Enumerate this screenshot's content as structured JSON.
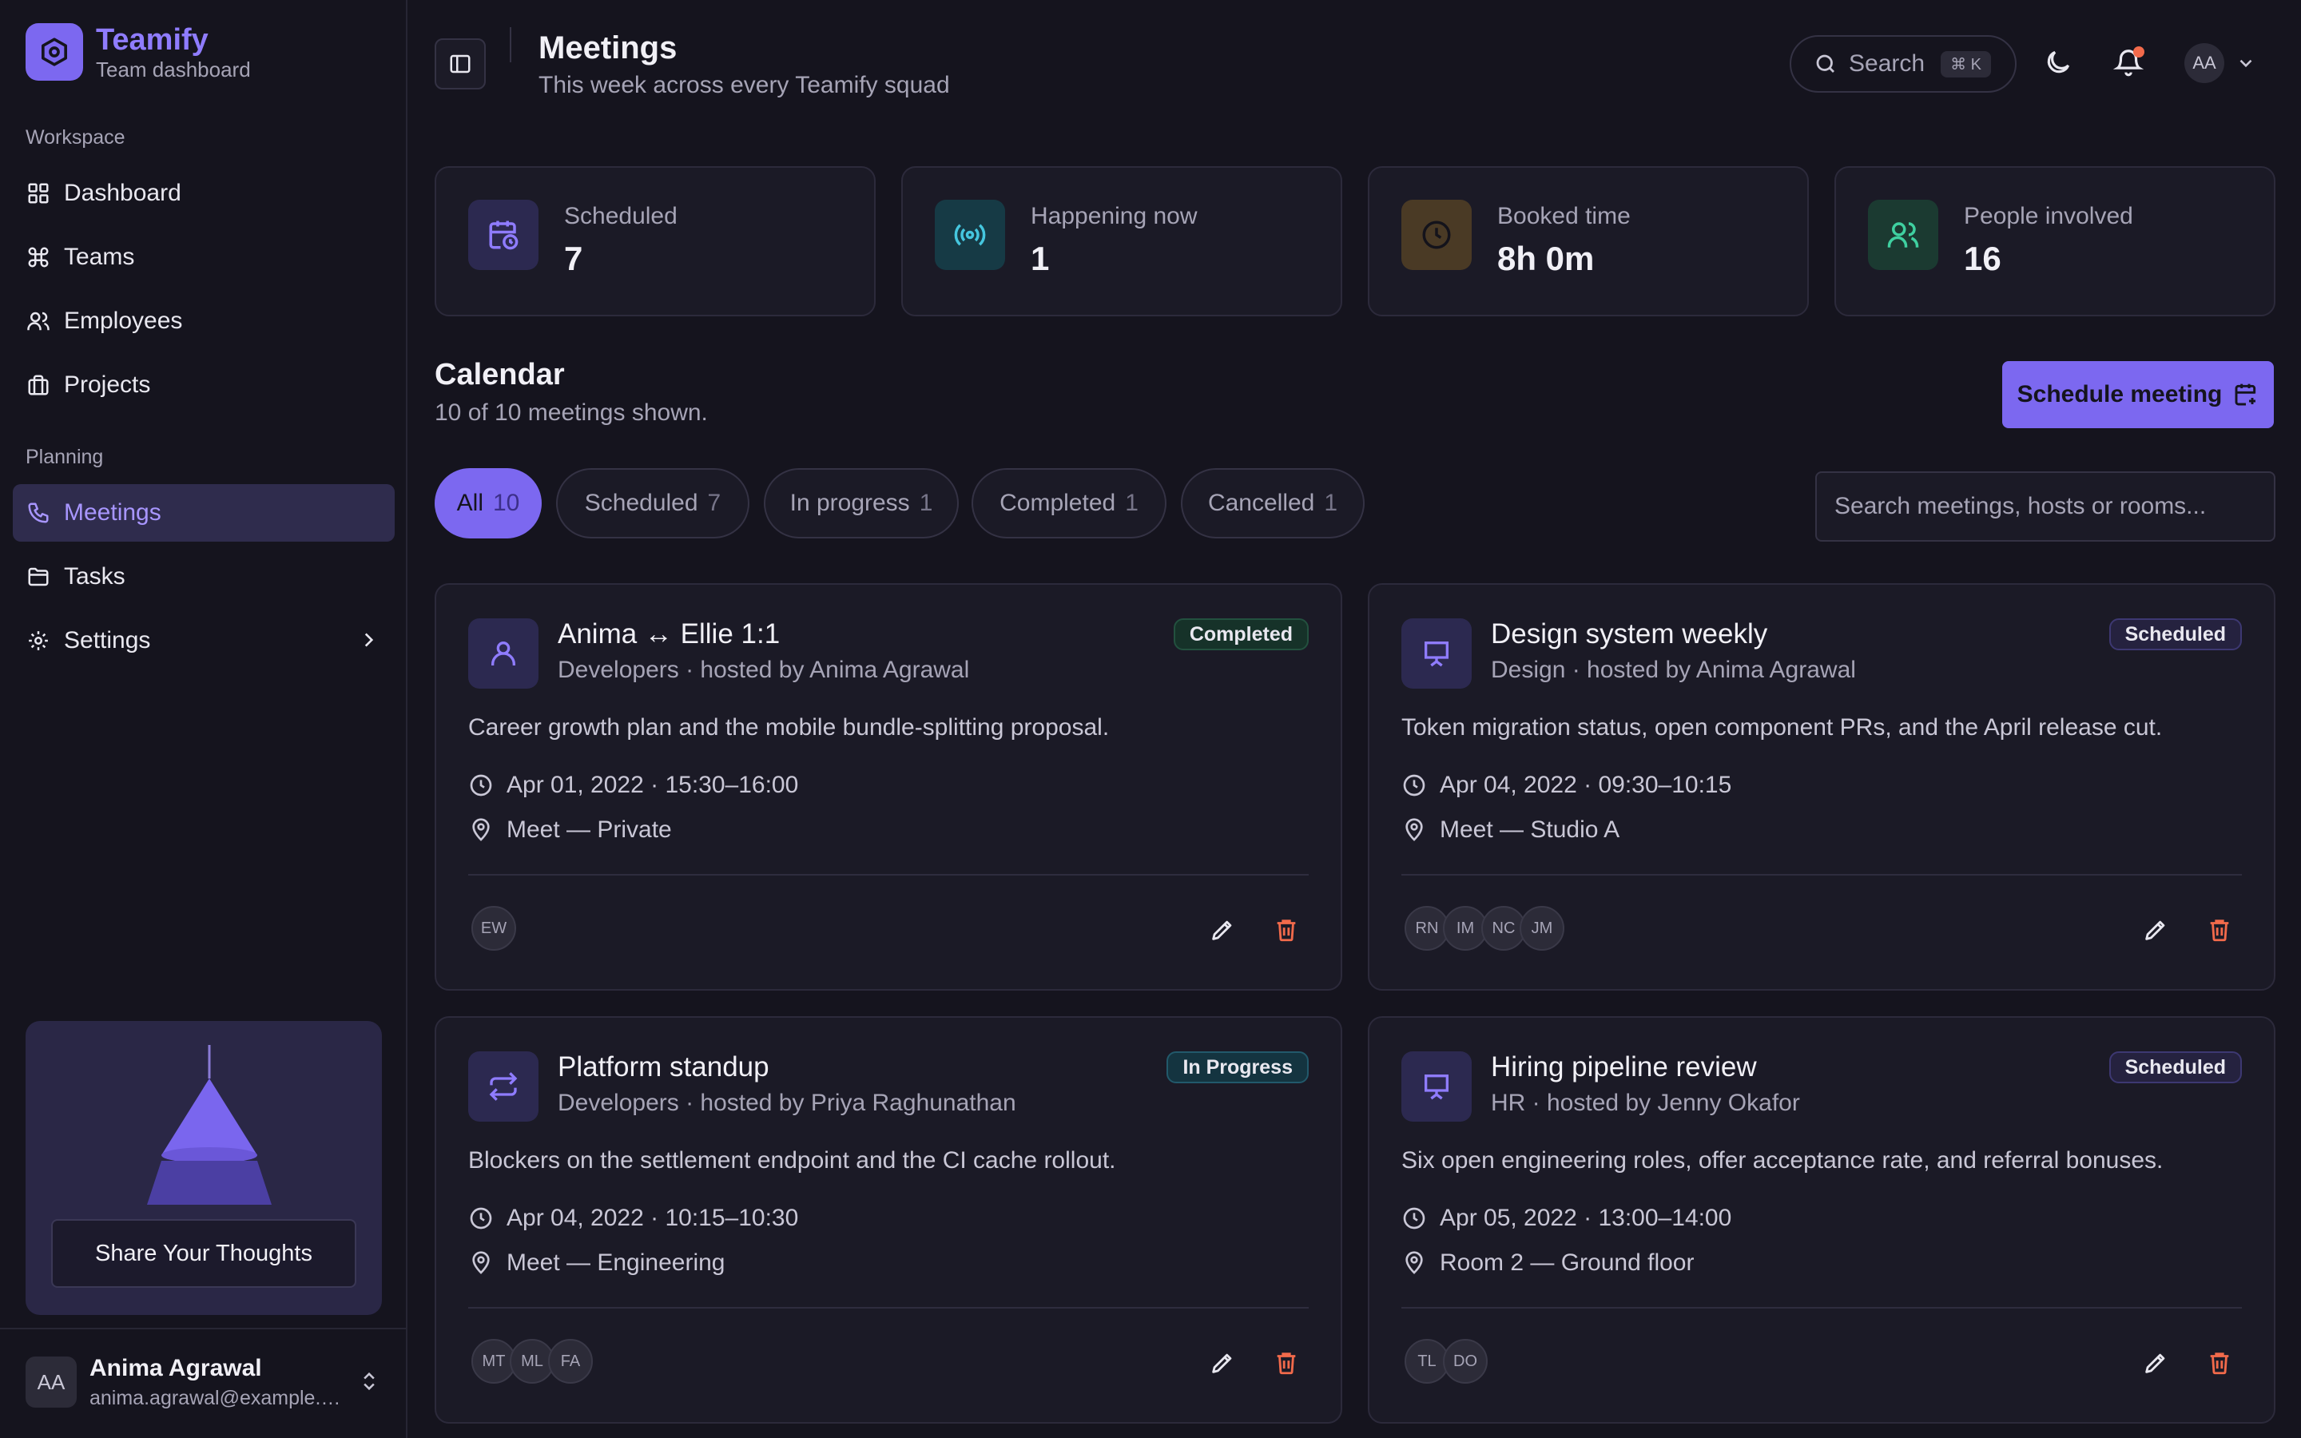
{
  "brand": {
    "name": "Teamify",
    "subtitle": "Team dashboard"
  },
  "sidebar": {
    "section_workspace": "Workspace",
    "section_planning": "Planning",
    "items": [
      {
        "label": "Dashboard",
        "icon": "grid-icon"
      },
      {
        "label": "Teams",
        "icon": "command-icon"
      },
      {
        "label": "Employees",
        "icon": "users-icon"
      },
      {
        "label": "Projects",
        "icon": "briefcase-icon"
      },
      {
        "label": "Meetings",
        "icon": "phone-icon",
        "active": true
      },
      {
        "label": "Tasks",
        "icon": "folder-icon"
      },
      {
        "label": "Settings",
        "icon": "gear-icon"
      }
    ],
    "promo_button": "Share Your Thoughts",
    "user": {
      "initials": "AA",
      "name": "Anima Agrawal",
      "email": "anima.agrawal@example.com"
    }
  },
  "header": {
    "title": "Meetings",
    "subtitle": "This week across every Teamify squad",
    "search_label": "Search",
    "search_shortcut": "⌘ K",
    "avatar_initials": "AA"
  },
  "stats": [
    {
      "label": "Scheduled",
      "value": "7"
    },
    {
      "label": "Happening now",
      "value": "1"
    },
    {
      "label": "Booked time",
      "value": "8h 0m"
    },
    {
      "label": "People involved",
      "value": "16"
    }
  ],
  "calendar": {
    "title": "Calendar",
    "subtitle": "10 of 10 meetings shown.",
    "schedule_button": "Schedule meeting",
    "search_placeholder": "Search meetings, hosts or rooms...",
    "filters": [
      {
        "label": "All",
        "count": "10",
        "active": true
      },
      {
        "label": "Scheduled",
        "count": "7"
      },
      {
        "label": "In progress",
        "count": "1"
      },
      {
        "label": "Completed",
        "count": "1"
      },
      {
        "label": "Cancelled",
        "count": "1"
      }
    ]
  },
  "meetings": [
    {
      "title": "Anima ↔ Ellie 1:1",
      "subtitle": "Developers · hosted by Anima Agrawal",
      "status": "Completed",
      "description": "Career growth plan and the mobile bundle-splitting proposal.",
      "time": "Apr 01, 2022 · 15:30–16:00",
      "location": "Meet — Private",
      "attendees": [
        "EW"
      ],
      "icon": "person-icon"
    },
    {
      "title": "Design system weekly",
      "subtitle": "Design · hosted by Anima Agrawal",
      "status": "Scheduled",
      "description": "Token migration status, open component PRs, and the April release cut.",
      "time": "Apr 04, 2022 · 09:30–10:15",
      "location": "Meet — Studio A",
      "attendees": [
        "RN",
        "IM",
        "NC",
        "JM"
      ],
      "icon": "presentation-icon"
    },
    {
      "title": "Platform standup",
      "subtitle": "Developers · hosted by Priya Raghunathan",
      "status": "In Progress",
      "description": "Blockers on the settlement endpoint and the CI cache rollout.",
      "time": "Apr 04, 2022 · 10:15–10:30",
      "location": "Meet — Engineering",
      "attendees": [
        "MT",
        "ML",
        "FA"
      ],
      "icon": "repeat-icon"
    },
    {
      "title": "Hiring pipeline review",
      "subtitle": "HR · hosted by Jenny Okafor",
      "status": "Scheduled",
      "description": "Six open engineering roles, offer acceptance rate, and referral bonuses.",
      "time": "Apr 05, 2022 · 13:00–14:00",
      "location": "Room 2 — Ground floor",
      "attendees": [
        "TL",
        "DO"
      ],
      "icon": "presentation-icon"
    }
  ],
  "colors": {
    "accent": "#7c68f0",
    "background": "#15141e",
    "danger": "#f26a4b"
  }
}
